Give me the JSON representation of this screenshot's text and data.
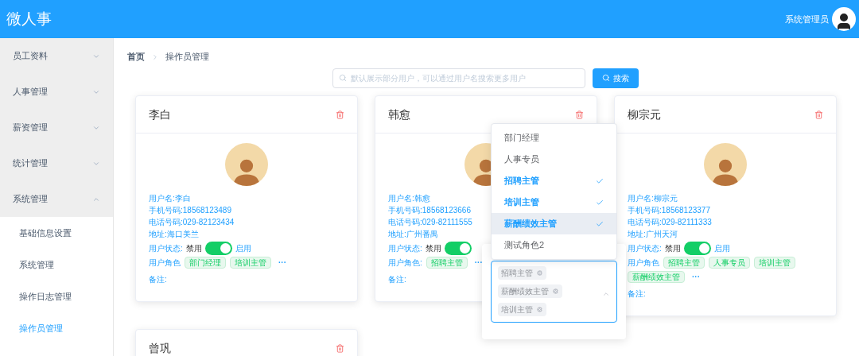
{
  "header": {
    "title": "微人事",
    "user": "系统管理员"
  },
  "sidebar": {
    "items": [
      {
        "label": "员工资料",
        "expanded": false
      },
      {
        "label": "人事管理",
        "expanded": false
      },
      {
        "label": "薪资管理",
        "expanded": false
      },
      {
        "label": "统计管理",
        "expanded": false
      },
      {
        "label": "系统管理",
        "expanded": true,
        "children": [
          {
            "label": "基础信息设置",
            "selected": false
          },
          {
            "label": "系统管理",
            "selected": false
          },
          {
            "label": "操作日志管理",
            "selected": false
          },
          {
            "label": "操作员管理",
            "selected": true
          }
        ]
      }
    ]
  },
  "breadcrumb": [
    "首页",
    "操作员管理"
  ],
  "search": {
    "placeholder": "默认展示部分用户，可以通过用户名搜索更多用户",
    "button": "搜索"
  },
  "cards": [
    {
      "name": "李白",
      "lines": [
        "用户名:李白",
        "手机号码:18568123489",
        "电话号码:029-82123434",
        "地址:海口美兰"
      ],
      "status_label": "用户状态:",
      "off_label": "禁用",
      "on": true,
      "on_label": "启用",
      "roles_label": "用户角色",
      "roles": [
        "部门经理",
        "培训主管"
      ],
      "more": "···",
      "remark": "备注:"
    },
    {
      "name": "韩愈",
      "lines": [
        "用户名:韩愈",
        "手机号码:18568123666",
        "电话号码:029-82111555",
        "地址:广州番禺"
      ],
      "status_label": "用户状态:",
      "off_label": "禁用",
      "on": true,
      "roles_label": "用户角色:",
      "roles": [
        "招聘主管"
      ],
      "more": "···",
      "remark": "备注:"
    },
    {
      "name": "柳宗元",
      "lines": [
        "用户名:柳宗元",
        "手机号码:18568123377",
        "电话号码:029-82111333",
        "地址:广州天河"
      ],
      "status_label": "用户状态:",
      "off_label": "禁用",
      "on": true,
      "on_label": "启用",
      "roles_label": "用户角色",
      "roles": [
        "招聘主管",
        "人事专员",
        "培训主管",
        "薪酬绩效主管"
      ],
      "more": "···",
      "remark": "备注:"
    },
    {
      "name": "曾巩"
    }
  ],
  "role_dropdown": {
    "options": [
      {
        "label": "部门经理",
        "selected": false,
        "hovered": false
      },
      {
        "label": "人事专员",
        "selected": false,
        "hovered": false
      },
      {
        "label": "招聘主管",
        "selected": true,
        "hovered": false
      },
      {
        "label": "培训主管",
        "selected": true,
        "hovered": false
      },
      {
        "label": "薪酬绩效主管",
        "selected": true,
        "hovered": true
      },
      {
        "label": "测试角色2",
        "selected": false,
        "hovered": false
      }
    ],
    "tags": [
      "招聘主管",
      "薪酬绩效主管",
      "培训主管"
    ]
  }
}
